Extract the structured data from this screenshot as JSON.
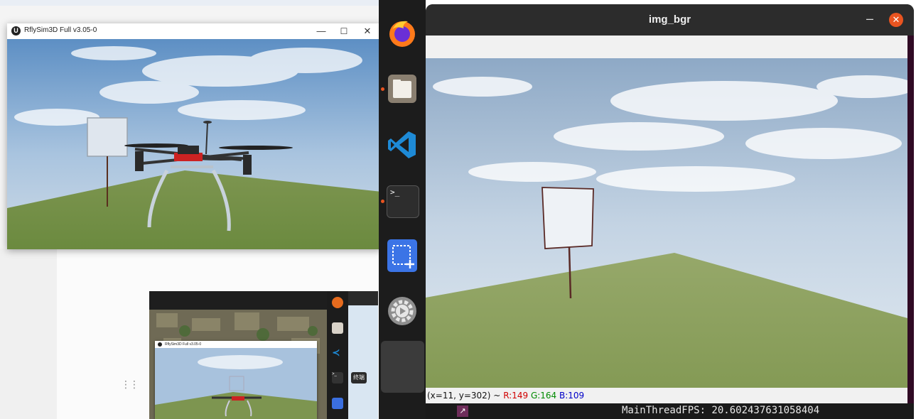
{
  "rflysim_window": {
    "title": "RflySim3D Full v3.05-0",
    "logo_glyph": "U",
    "minimize": "—",
    "maximize": "☐",
    "close": "✕"
  },
  "img_window": {
    "title": "img_bgr",
    "minimize": "–",
    "close": "✕",
    "status": {
      "position": "(x=11, y=302) ~",
      "r": "R:149",
      "g": "G:164",
      "b": "B:109"
    }
  },
  "terminal": {
    "fps_line": "MainThreadFPS: 20.602437631058404",
    "icon_glyph": "↗"
  },
  "dock": {
    "apps": [
      {
        "name": "firefox",
        "icon": "firefox-icon",
        "running": false
      },
      {
        "name": "files",
        "icon": "files-icon",
        "running": true
      },
      {
        "name": "vscode",
        "icon": "vscode-icon",
        "running": false
      },
      {
        "name": "terminal",
        "icon": "terminal-icon",
        "running": true,
        "glyph": ">_"
      },
      {
        "name": "screenshot",
        "icon": "screenshot-icon",
        "running": false
      },
      {
        "name": "settings",
        "icon": "settings-icon",
        "running": false
      }
    ]
  },
  "nested_preview": {
    "window_title": "RflySim3D Full v3.05-0",
    "tooltip": "终端"
  },
  "colors": {
    "dock_bg": "#1c1c1c",
    "ubuntu_orange": "#e95420",
    "terminal_purple": "#300a24"
  }
}
